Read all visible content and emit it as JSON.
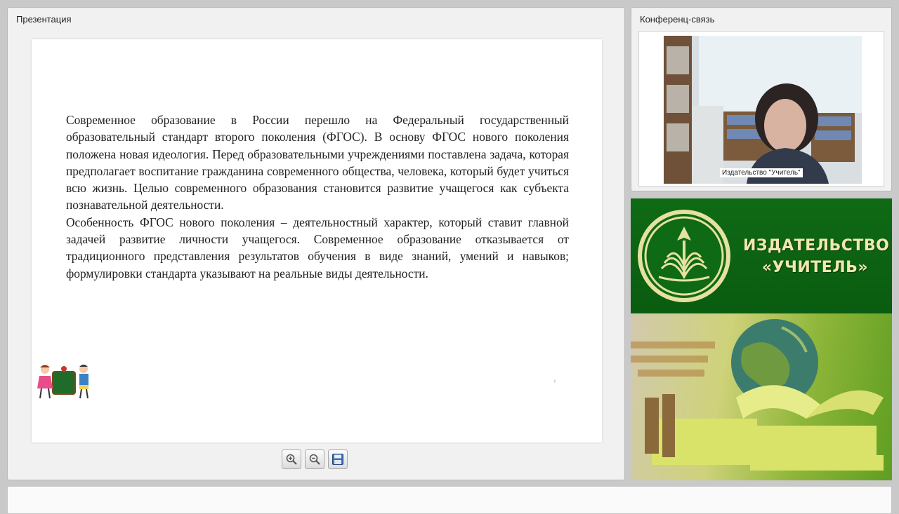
{
  "presentation": {
    "title": "Презентация",
    "paragraphs": [
      "Современное образование в России перешло на Федеральный государственный образовательный стандарт второго поколения (ФГОС). В основу ФГОС нового поколения положена новая идеология. Перед образовательными учреждениями поставлена задача, которая предполагает воспитание гражданина современного общества, человека, который будет учиться всю жизнь. Целью современного образования становится развитие учащегося как субъекта познавательной деятельности.",
      "Особенность ФГОС нового поколения – деятельностный характер, который ставит главной задачей развитие личности учащегося. Современное образование отказывается от традиционного представления результатов обучения в виде знаний, умений и навыков; формулировки стандарта указывают на реальные виды деятельности."
    ],
    "toolbar_icons": [
      "zoom-in-icon",
      "zoom-out-icon",
      "save-icon"
    ]
  },
  "conference": {
    "title": "Конференц-связь",
    "participant_label": "Издательство \"Учитель\""
  },
  "banner": {
    "line1": "ИЗДАТЕЛЬСТВО",
    "line2": "«УЧИТЕЛЬ»",
    "colors": {
      "green": "#0b6312",
      "text": "#f2e7b0",
      "logo_ring": "#e6e1a0"
    }
  }
}
